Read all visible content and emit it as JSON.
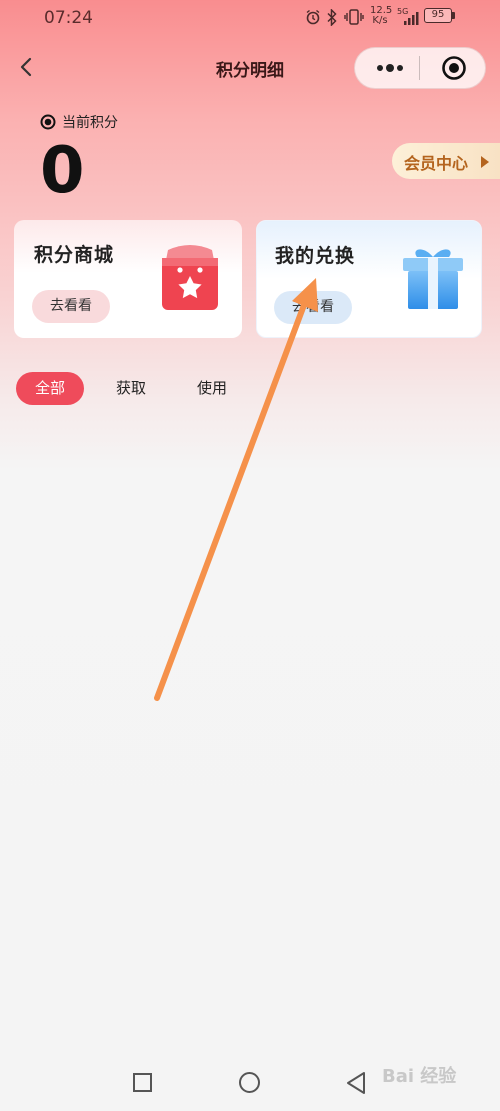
{
  "status_bar": {
    "time": "07:24",
    "net_speed_value": "12.5",
    "net_speed_unit": "K/s",
    "signal": "5G",
    "battery": "95"
  },
  "nav": {
    "title": "积分明细"
  },
  "points": {
    "label": "当前积分",
    "value": "0",
    "member_center": "会员中心"
  },
  "cards": [
    {
      "title": "积分商城",
      "button": "去看看",
      "icon": "shopping-bag-star-icon",
      "accent": "#ef4450"
    },
    {
      "title": "我的兑换",
      "button": "去看看",
      "icon": "gift-box-icon",
      "accent": "#3d9df0"
    }
  ],
  "tabs": [
    {
      "label": "全部",
      "active": true
    },
    {
      "label": "获取",
      "active": false
    },
    {
      "label": "使用",
      "active": false
    }
  ],
  "watermark": "Bai 经验",
  "colors": {
    "primary": "#ef4b5b",
    "member_text": "#b4641e",
    "annotation_arrow": "#f5914a"
  }
}
